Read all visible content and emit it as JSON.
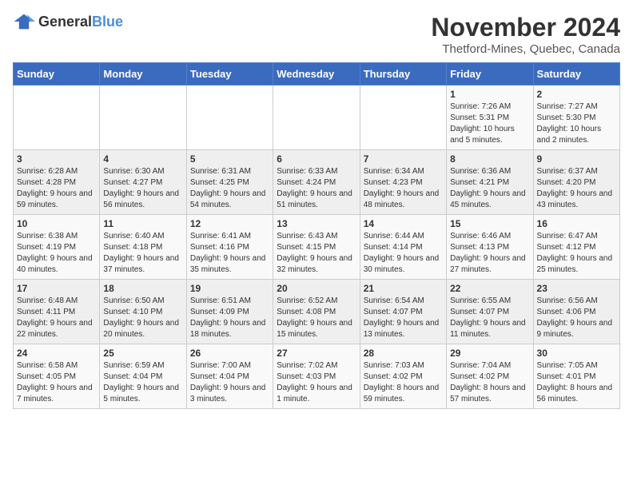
{
  "logo": {
    "text_general": "General",
    "text_blue": "Blue"
  },
  "title": "November 2024",
  "subtitle": "Thetford-Mines, Quebec, Canada",
  "days_of_week": [
    "Sunday",
    "Monday",
    "Tuesday",
    "Wednesday",
    "Thursday",
    "Friday",
    "Saturday"
  ],
  "weeks": [
    [
      {
        "day": "",
        "info": ""
      },
      {
        "day": "",
        "info": ""
      },
      {
        "day": "",
        "info": ""
      },
      {
        "day": "",
        "info": ""
      },
      {
        "day": "",
        "info": ""
      },
      {
        "day": "1",
        "info": "Sunrise: 7:26 AM\nSunset: 5:31 PM\nDaylight: 10 hours and 5 minutes."
      },
      {
        "day": "2",
        "info": "Sunrise: 7:27 AM\nSunset: 5:30 PM\nDaylight: 10 hours and 2 minutes."
      }
    ],
    [
      {
        "day": "3",
        "info": "Sunrise: 6:28 AM\nSunset: 4:28 PM\nDaylight: 9 hours and 59 minutes."
      },
      {
        "day": "4",
        "info": "Sunrise: 6:30 AM\nSunset: 4:27 PM\nDaylight: 9 hours and 56 minutes."
      },
      {
        "day": "5",
        "info": "Sunrise: 6:31 AM\nSunset: 4:25 PM\nDaylight: 9 hours and 54 minutes."
      },
      {
        "day": "6",
        "info": "Sunrise: 6:33 AM\nSunset: 4:24 PM\nDaylight: 9 hours and 51 minutes."
      },
      {
        "day": "7",
        "info": "Sunrise: 6:34 AM\nSunset: 4:23 PM\nDaylight: 9 hours and 48 minutes."
      },
      {
        "day": "8",
        "info": "Sunrise: 6:36 AM\nSunset: 4:21 PM\nDaylight: 9 hours and 45 minutes."
      },
      {
        "day": "9",
        "info": "Sunrise: 6:37 AM\nSunset: 4:20 PM\nDaylight: 9 hours and 43 minutes."
      }
    ],
    [
      {
        "day": "10",
        "info": "Sunrise: 6:38 AM\nSunset: 4:19 PM\nDaylight: 9 hours and 40 minutes."
      },
      {
        "day": "11",
        "info": "Sunrise: 6:40 AM\nSunset: 4:18 PM\nDaylight: 9 hours and 37 minutes."
      },
      {
        "day": "12",
        "info": "Sunrise: 6:41 AM\nSunset: 4:16 PM\nDaylight: 9 hours and 35 minutes."
      },
      {
        "day": "13",
        "info": "Sunrise: 6:43 AM\nSunset: 4:15 PM\nDaylight: 9 hours and 32 minutes."
      },
      {
        "day": "14",
        "info": "Sunrise: 6:44 AM\nSunset: 4:14 PM\nDaylight: 9 hours and 30 minutes."
      },
      {
        "day": "15",
        "info": "Sunrise: 6:46 AM\nSunset: 4:13 PM\nDaylight: 9 hours and 27 minutes."
      },
      {
        "day": "16",
        "info": "Sunrise: 6:47 AM\nSunset: 4:12 PM\nDaylight: 9 hours and 25 minutes."
      }
    ],
    [
      {
        "day": "17",
        "info": "Sunrise: 6:48 AM\nSunset: 4:11 PM\nDaylight: 9 hours and 22 minutes."
      },
      {
        "day": "18",
        "info": "Sunrise: 6:50 AM\nSunset: 4:10 PM\nDaylight: 9 hours and 20 minutes."
      },
      {
        "day": "19",
        "info": "Sunrise: 6:51 AM\nSunset: 4:09 PM\nDaylight: 9 hours and 18 minutes."
      },
      {
        "day": "20",
        "info": "Sunrise: 6:52 AM\nSunset: 4:08 PM\nDaylight: 9 hours and 15 minutes."
      },
      {
        "day": "21",
        "info": "Sunrise: 6:54 AM\nSunset: 4:07 PM\nDaylight: 9 hours and 13 minutes."
      },
      {
        "day": "22",
        "info": "Sunrise: 6:55 AM\nSunset: 4:07 PM\nDaylight: 9 hours and 11 minutes."
      },
      {
        "day": "23",
        "info": "Sunrise: 6:56 AM\nSunset: 4:06 PM\nDaylight: 9 hours and 9 minutes."
      }
    ],
    [
      {
        "day": "24",
        "info": "Sunrise: 6:58 AM\nSunset: 4:05 PM\nDaylight: 9 hours and 7 minutes."
      },
      {
        "day": "25",
        "info": "Sunrise: 6:59 AM\nSunset: 4:04 PM\nDaylight: 9 hours and 5 minutes."
      },
      {
        "day": "26",
        "info": "Sunrise: 7:00 AM\nSunset: 4:04 PM\nDaylight: 9 hours and 3 minutes."
      },
      {
        "day": "27",
        "info": "Sunrise: 7:02 AM\nSunset: 4:03 PM\nDaylight: 9 hours and 1 minute."
      },
      {
        "day": "28",
        "info": "Sunrise: 7:03 AM\nSunset: 4:02 PM\nDaylight: 8 hours and 59 minutes."
      },
      {
        "day": "29",
        "info": "Sunrise: 7:04 AM\nSunset: 4:02 PM\nDaylight: 8 hours and 57 minutes."
      },
      {
        "day": "30",
        "info": "Sunrise: 7:05 AM\nSunset: 4:01 PM\nDaylight: 8 hours and 56 minutes."
      }
    ]
  ]
}
